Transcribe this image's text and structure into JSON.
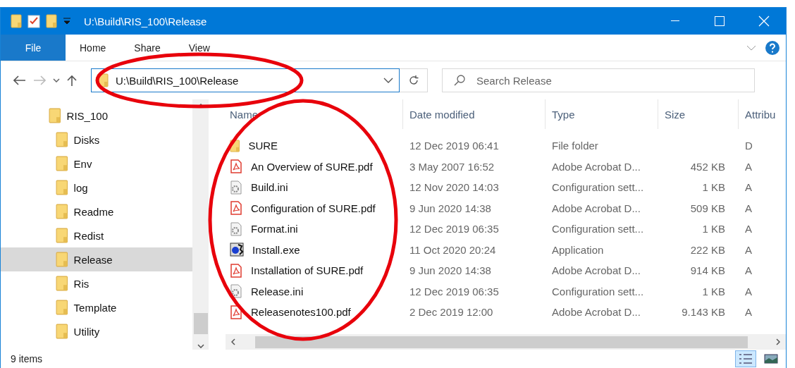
{
  "title_bar": {
    "title": "U:\\Build\\RIS_100\\Release"
  },
  "ribbon": {
    "tabs": [
      {
        "label": "File",
        "kind": "file",
        "selected": false
      },
      {
        "label": "Home",
        "kind": "tab",
        "selected": false
      },
      {
        "label": "Share",
        "kind": "tab",
        "selected": false
      },
      {
        "label": "View",
        "kind": "tab",
        "selected": false
      }
    ]
  },
  "address": {
    "path": "U:\\Build\\RIS_100\\Release"
  },
  "search": {
    "placeholder": "Search Release"
  },
  "navigation": {
    "items": [
      {
        "label": "RIS_100",
        "selected": false,
        "children": [
          {
            "label": "Disks",
            "selected": false
          },
          {
            "label": "Env",
            "selected": false
          },
          {
            "label": "log",
            "selected": false
          },
          {
            "label": "Readme",
            "selected": false
          },
          {
            "label": "Redist",
            "selected": false
          },
          {
            "label": "Release",
            "selected": true
          },
          {
            "label": "Ris",
            "selected": false
          },
          {
            "label": "Template",
            "selected": false
          },
          {
            "label": "Utility",
            "selected": false
          }
        ]
      }
    ]
  },
  "table": {
    "columns": [
      "Name",
      "Date modified",
      "Type",
      "Size",
      "Attribu"
    ],
    "rows": [
      {
        "name": "SURE",
        "kind": "folder",
        "date": "12 Dec 2019 06:41",
        "type": "File folder",
        "size": "",
        "attributes": "D"
      },
      {
        "name": "An Overview of SURE.pdf",
        "kind": "pdf",
        "date": "3 May 2007 16:52",
        "type": "Adobe Acrobat D...",
        "size": "452 KB",
        "attributes": "A"
      },
      {
        "name": "Build.ini",
        "kind": "ini",
        "date": "12 Nov 2020 14:03",
        "type": "Configuration sett...",
        "size": "1 KB",
        "attributes": "A"
      },
      {
        "name": "Configuration of SURE.pdf",
        "kind": "pdf",
        "date": "9 Jun 2020 14:38",
        "type": "Adobe Acrobat D...",
        "size": "509 KB",
        "attributes": "A"
      },
      {
        "name": "Format.ini",
        "kind": "ini",
        "date": "12 Dec 2019 06:35",
        "type": "Configuration sett...",
        "size": "1 KB",
        "attributes": "A"
      },
      {
        "name": "Install.exe",
        "kind": "exe",
        "date": "11 Oct 2020 20:24",
        "type": "Application",
        "size": "222 KB",
        "attributes": "A"
      },
      {
        "name": "Installation of SURE.pdf",
        "kind": "pdf",
        "date": "9 Jun 2020 14:38",
        "type": "Adobe Acrobat D...",
        "size": "914 KB",
        "attributes": "A"
      },
      {
        "name": "Release.ini",
        "kind": "ini",
        "date": "12 Dec 2019 06:35",
        "type": "Configuration sett...",
        "size": "1 KB",
        "attributes": "A"
      },
      {
        "name": "Releasenotes100.pdf",
        "kind": "pdf",
        "date": "2 Dec 2019 12:00",
        "type": "Adobe Acrobat D...",
        "size": "9.143 KB",
        "attributes": "A"
      }
    ]
  },
  "status_bar": {
    "text": "9 items"
  }
}
